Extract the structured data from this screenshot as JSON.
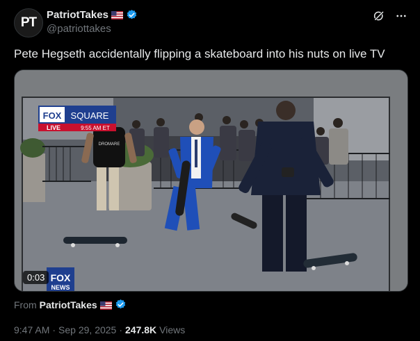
{
  "author": {
    "avatar_text": "PT",
    "display_name": "PatriotTakes",
    "handle": "@patriottakes"
  },
  "tweet": {
    "text": "Pete Hegseth accidentally flipping a skateboard into his nuts on live TV"
  },
  "video": {
    "duration": "0:03",
    "banner_brand": "FOX",
    "banner_location": "SQUARE",
    "banner_live": "LIVE",
    "banner_time": "9:55 AM ET",
    "corner_logo": "FOX",
    "corner_logo_sub": "NEWS",
    "shirt_text": "DROMARE"
  },
  "attribution": {
    "from_label": "From",
    "from_name": "PatriotTakes"
  },
  "meta": {
    "time": "9:47 AM",
    "date": "Sep 29, 2025",
    "views_count": "247.8K",
    "views_label": "Views",
    "separator": "·"
  },
  "icons": {
    "verified": "verified-badge-icon",
    "flag": "us-flag-icon",
    "grok": "grok-icon",
    "more": "more-icon"
  },
  "colors": {
    "background": "#000000",
    "text": "#e7e9ea",
    "muted": "#71767b",
    "verified_blue": "#1d9bf0",
    "fox_red": "#c8102e",
    "fox_blue": "#1f3f8f"
  }
}
